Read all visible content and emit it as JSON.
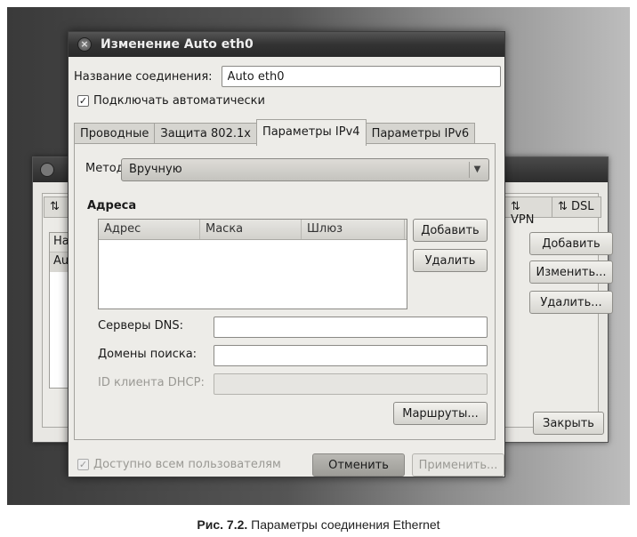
{
  "background_window": {
    "tabs": [
      "VPN",
      "DSL"
    ],
    "list_header": "На",
    "list_row": "Au",
    "buttons": {
      "add": "Добавить",
      "edit": "Изменить...",
      "delete": "Удалить..."
    },
    "close_label": "Закрыть"
  },
  "dialog": {
    "title": "Изменение Auto eth0",
    "connection_name_label": "Название соединения:",
    "connection_name_value": "Auto eth0",
    "auto_connect_label": "Подключать автоматически",
    "tabs": [
      "Проводные",
      "Защита 802.1x",
      "Параметры IPv4",
      "Параметры IPv6"
    ],
    "active_tab": "Параметры IPv4",
    "method_label": "Метод:",
    "method_value": "Вручную",
    "addresses_heading": "Адреса",
    "columns": [
      "Адрес",
      "Маска",
      "Шлюз"
    ],
    "add_button": "Добавить",
    "delete_button": "Удалить",
    "dns_label": "Серверы DNS:",
    "dns_value": "",
    "search_domains_label": "Домены поиска:",
    "search_domains_value": "",
    "dhcp_client_id_label": "ID клиента DHCP:",
    "dhcp_client_id_value": "",
    "routes_button": "Маршруты...",
    "available_all_users_label": "Доступно всем пользователям",
    "cancel_button": "Отменить",
    "apply_button": "Применить..."
  },
  "caption": {
    "prefix": "Рис. 7.2.",
    "text": " Параметры соединения Ethernet"
  }
}
